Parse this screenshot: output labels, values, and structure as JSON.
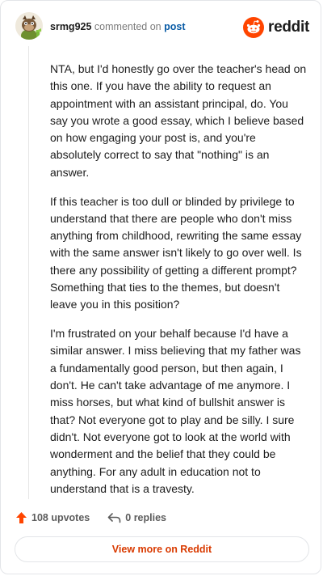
{
  "header": {
    "username": "srmg925",
    "action_text": "commented on",
    "post_link": "post",
    "brand": "reddit"
  },
  "comment": {
    "paragraphs": [
      "NTA, but I'd honestly go over the teacher's head on this one. If you have the ability to request an appointment with an assistant principal, do. You say you wrote a good essay, which I believe based on how engaging your post is, and you're absolutely correct to say that \"nothing\" is an answer.",
      "If this teacher is too dull or blinded by privilege to understand that there are people who don't miss anything from childhood, rewriting the same essay with the same answer isn't likely to go over well. Is there any possibility of getting a different prompt? Something that ties to the themes, but doesn't leave you in this position?",
      "I'm frustrated on your behalf because I'd have a similar answer. I miss believing that my father was a fundamentally good person, but then again, I don't. He can't take advantage of me anymore. I miss horses, but what kind of bullshit answer is that? Not everyone got to play and be silly. I sure didn't. Not everyone got to look at the world with wonderment and the belief that they could be anything. For any adult in education not to understand that is a travesty."
    ]
  },
  "actions": {
    "upvotes": "108 upvotes",
    "replies": "0 replies"
  },
  "footer": {
    "view_more": "View more on Reddit"
  },
  "icons": {
    "avatar": "snoo-avatar-icon",
    "brand": "reddit-logo-icon",
    "upvote": "upvote-arrow-icon",
    "reply": "reply-arrow-icon"
  },
  "colors": {
    "brand": "#ff4500",
    "upvote": "#ff4500",
    "link": "#0a5ca6",
    "view_more_text": "#d93a00"
  }
}
